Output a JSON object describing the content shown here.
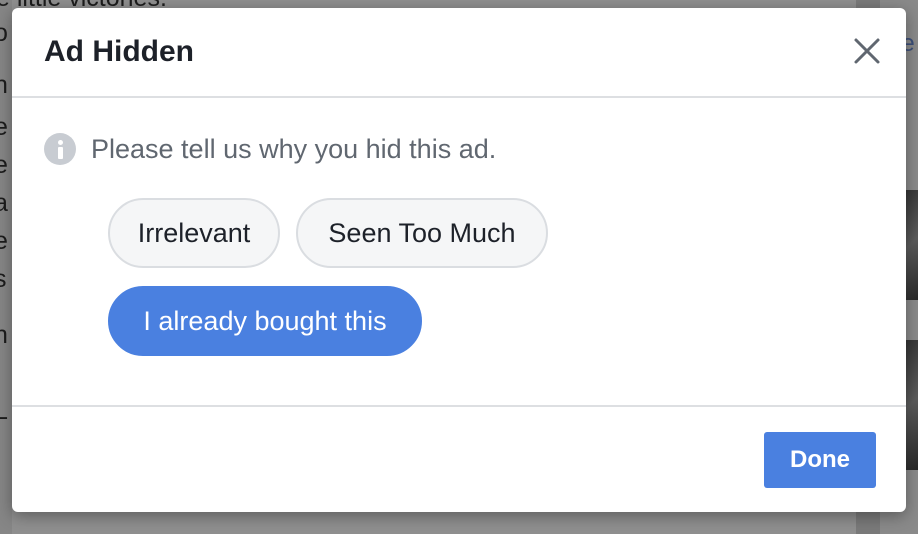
{
  "background": {
    "top_text": "e little victories."
  },
  "dialog": {
    "title": "Ad Hidden",
    "close_icon": "close-icon",
    "info_icon": "info-icon",
    "prompt": "Please tell us why you hid this ad.",
    "options": [
      {
        "label": "Irrelevant",
        "selected": false
      },
      {
        "label": "Seen Too Much",
        "selected": false
      },
      {
        "label": "I already bought this",
        "selected": true
      }
    ],
    "done_label": "Done"
  },
  "colors": {
    "accent": "#4a80e0",
    "title_text": "#1d2129",
    "muted_text": "#606770",
    "pill_bg": "#f5f6f7",
    "divider": "#dddfe2"
  }
}
